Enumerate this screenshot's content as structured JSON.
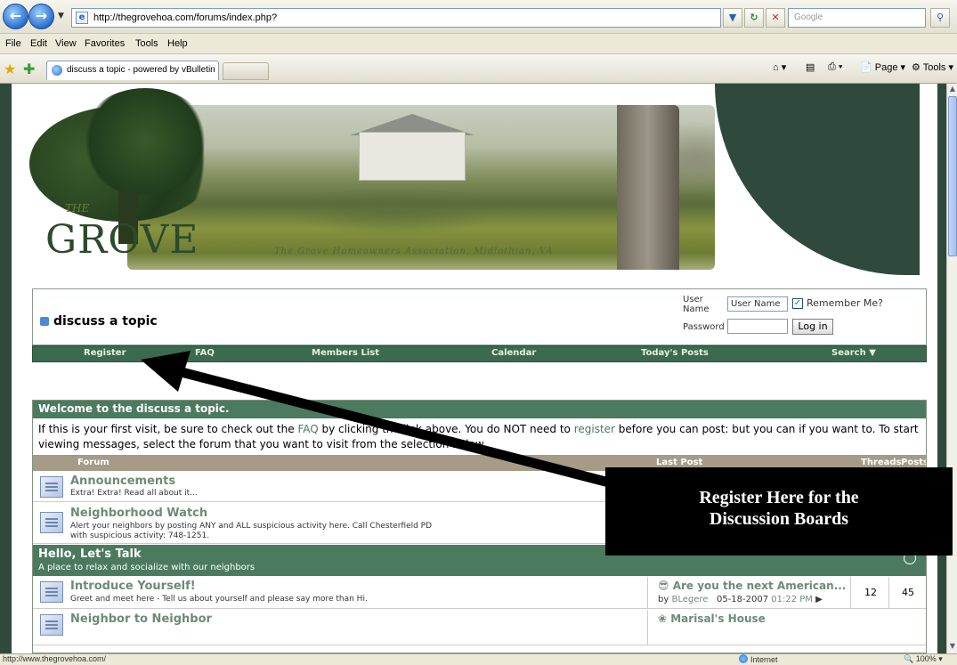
{
  "browser": {
    "url": "http://thegrovehoa.com/forums/index.php?",
    "search_placeholder": "Google",
    "menu": [
      "File",
      "Edit",
      "View",
      "Favorites",
      "Tools",
      "Help"
    ],
    "tab_title": "discuss a topic - powered by vBulletin",
    "commands": {
      "page": "Page",
      "tools": "Tools"
    },
    "status_url": "http://www.thegrovehoa.com/",
    "status_zone": "Internet",
    "status_zoom": "100%"
  },
  "banner": {
    "logo_the": "THE",
    "logo_grove": "GROVE",
    "caption": "The Grove Homeowners Association, Midlothian, VA"
  },
  "header": {
    "title": "discuss a topic",
    "login": {
      "user_label_1": "User",
      "user_label_2": "Name",
      "user_value": "User Name",
      "password_label": "Password",
      "remember_label": "Remember Me?",
      "login_button": "Log in"
    }
  },
  "navbar": {
    "items": [
      "Register",
      "FAQ",
      "Members List",
      "Calendar",
      "Today's Posts",
      "Search"
    ]
  },
  "forum": {
    "welcome_title": "Welcome to the discuss a topic.",
    "welcome_text_1": "If this is your first visit, be sure to check out the ",
    "welcome_faq": "FAQ",
    "welcome_text_2": " by clicking the link above. You do NOT need to ",
    "welcome_register": "register",
    "welcome_text_3": " before you can post: but you can if you want to. To start viewing messages, select the forum that you want to visit from the selection below.",
    "columns": {
      "forum": "Forum",
      "last_post": "Last Post",
      "threads": "Threads",
      "posts": "Posts"
    },
    "rows": [
      {
        "name": "Announcements",
        "desc": "Extra! Extra! Read all about it..."
      },
      {
        "name": "Neighborhood Watch",
        "desc": "Alert your neighbors by posting ANY and ALL suspicious activity here. Call Chesterfield PD with suspicious activity: 748-1251."
      }
    ],
    "category": {
      "title": "Hello, Let's Talk",
      "desc": "A place to relax and socialize with our neighbors"
    },
    "cat_rows": [
      {
        "name": "Introduce Yourself!",
        "desc": "Greet and meet here - Tell us about yourself and please say more than Hi.",
        "last_title": "Are you the next American...",
        "last_by": "by",
        "last_user": "BLegere",
        "last_date": "05-18-2007",
        "last_time": "01:22 PM",
        "threads": "12",
        "posts": "45"
      },
      {
        "name": "Neighbor to Neighbor",
        "last_title": "Marisal's House"
      }
    ]
  },
  "callout": {
    "line1": "Register Here for the",
    "line2": "Discussion Boards"
  }
}
